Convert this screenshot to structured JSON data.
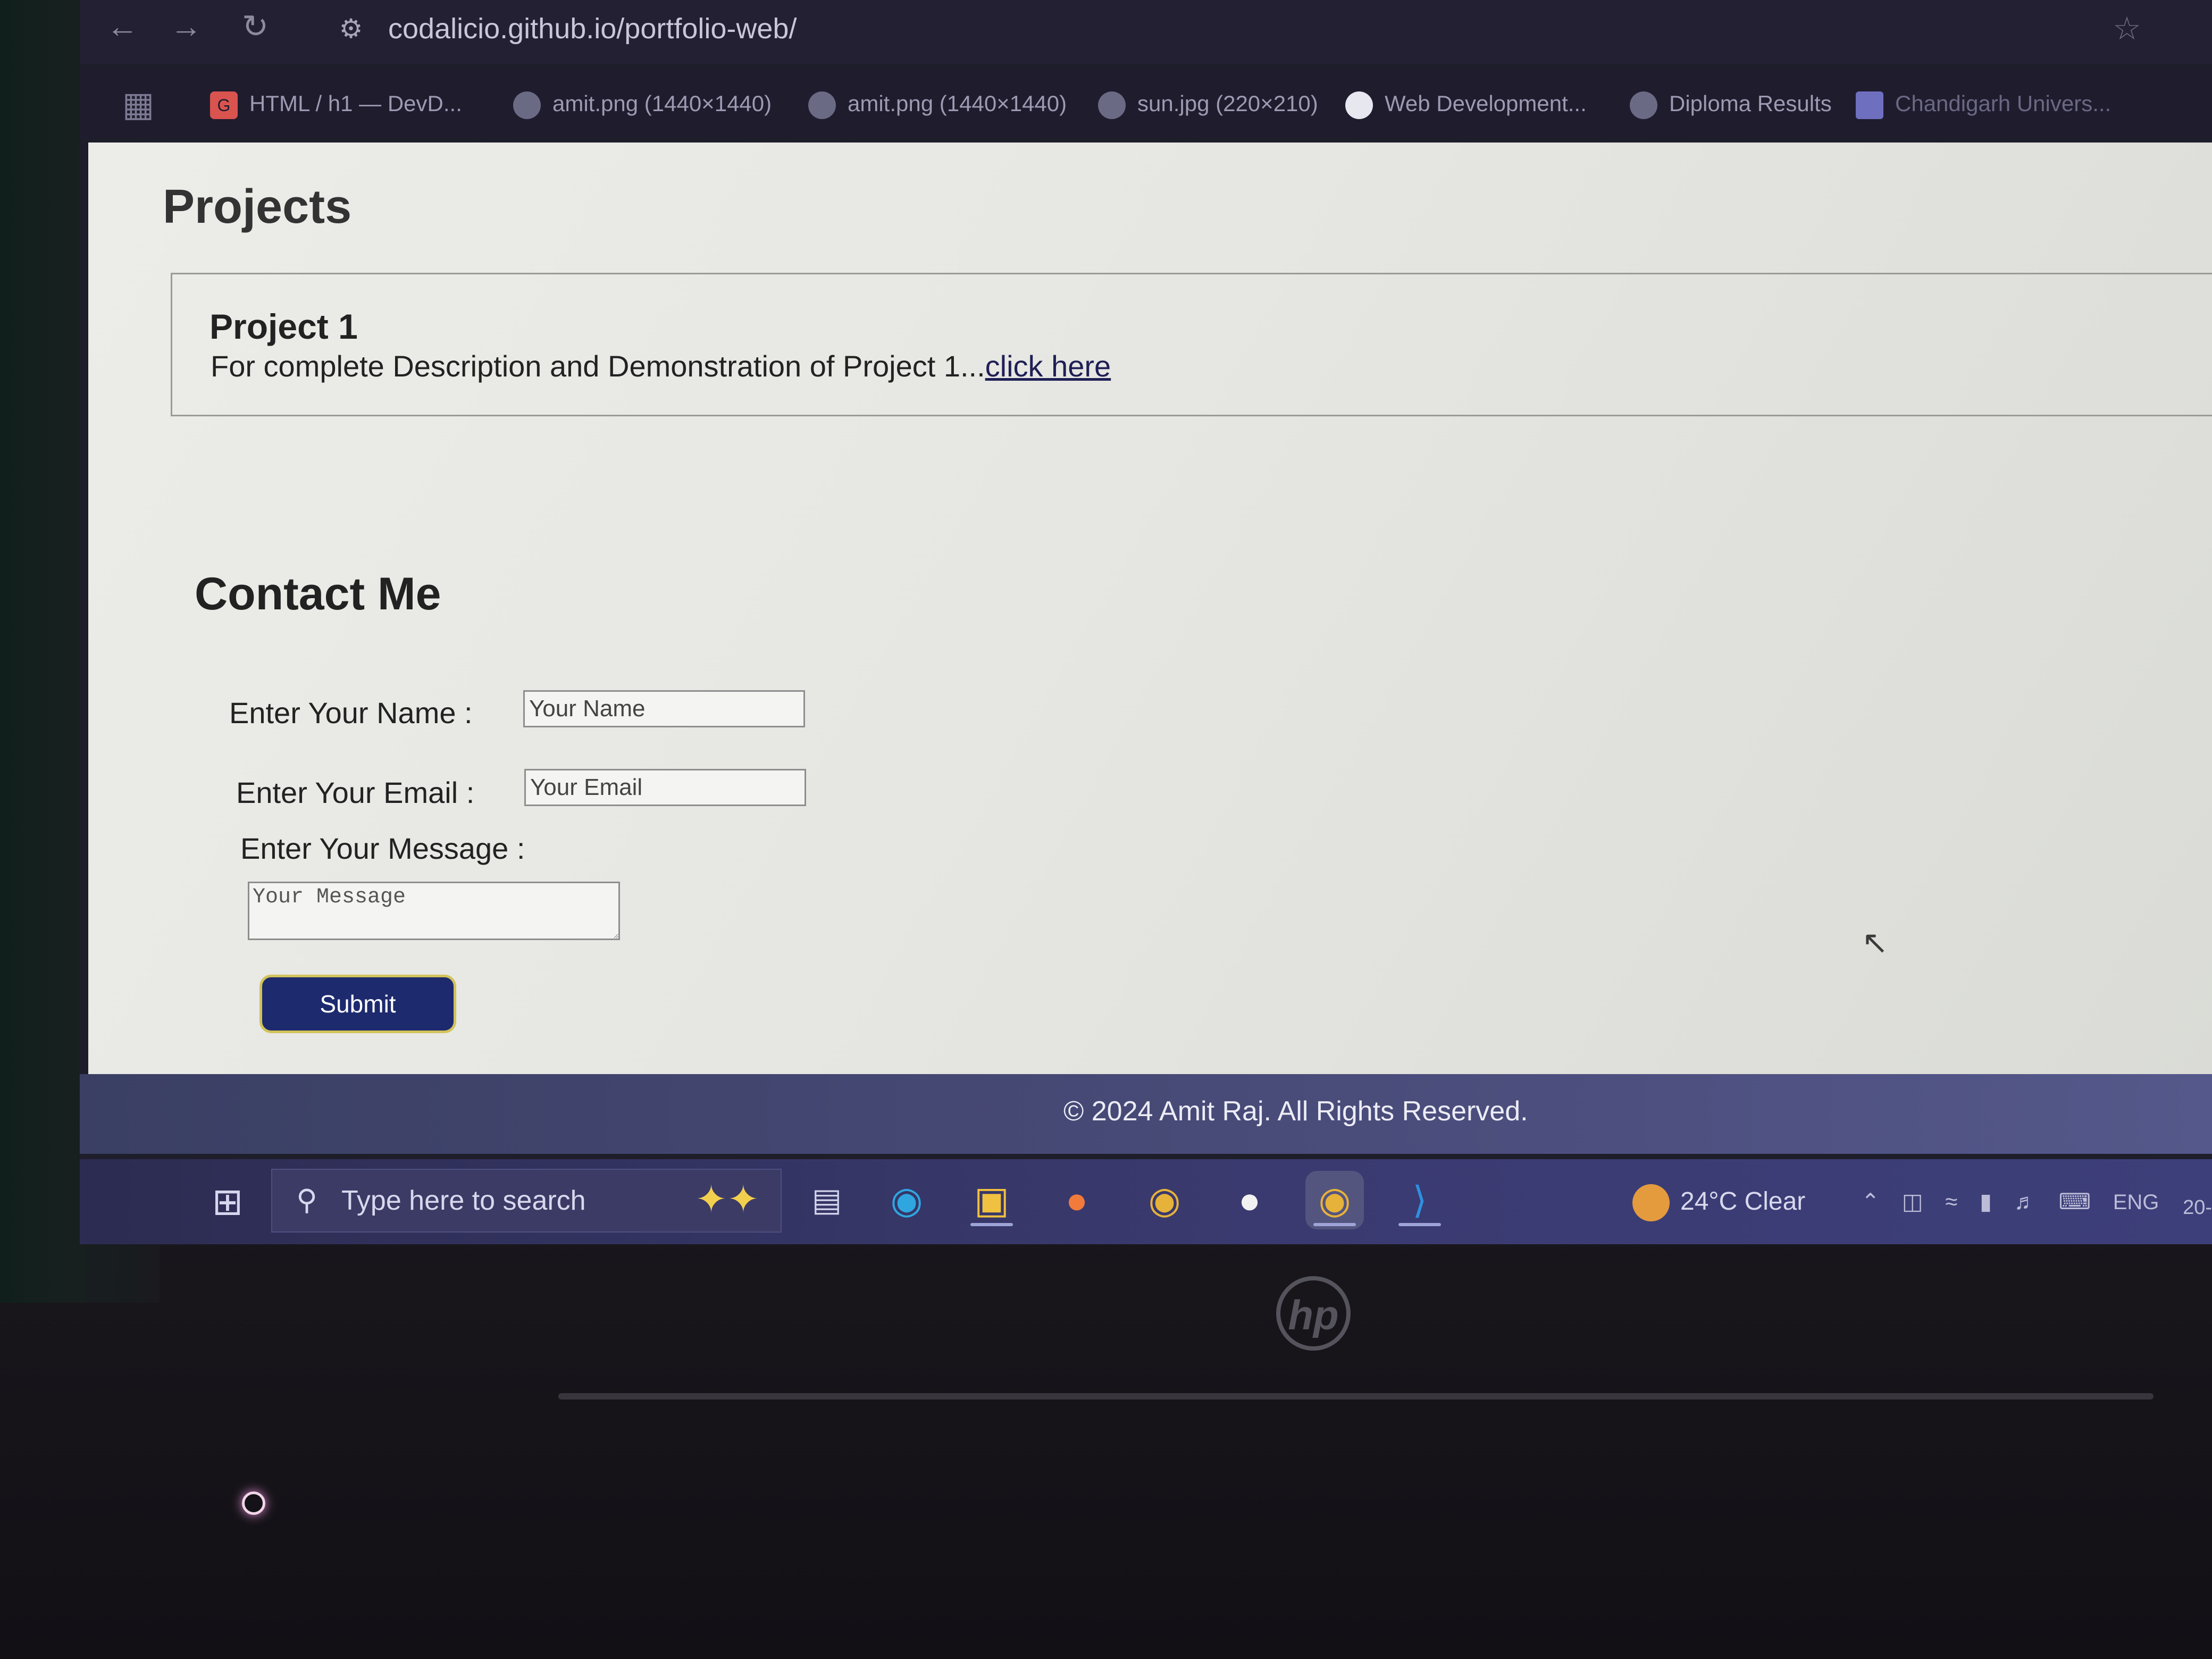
{
  "browser": {
    "url": "codalicio.github.io/portfolio-web/",
    "nav": {
      "back_icon": "arrow-left-icon",
      "forward_icon": "arrow-right-icon",
      "reload_icon": "reload-icon"
    },
    "bookmarks": [
      {
        "label": "HTML / h1 — DevD...",
        "icon": "devdocs-icon"
      },
      {
        "label": "amit.png (1440×1440)",
        "icon": "globe-icon"
      },
      {
        "label": "amit.png (1440×1440)",
        "icon": "globe-icon"
      },
      {
        "label": "sun.jpg (220×210)",
        "icon": "globe-icon"
      },
      {
        "label": "Web Development...",
        "icon": "site-icon"
      },
      {
        "label": "Diploma Results",
        "icon": "globe-icon"
      },
      {
        "label": "Chandigarh Univers...",
        "icon": "list-icon"
      }
    ]
  },
  "page": {
    "projects_title": "Projects",
    "project": {
      "name": "Project 1",
      "description": "For complete Description and Demonstration of Project 1...",
      "link_text": "click here"
    },
    "contact": {
      "title": "Contact Me",
      "name_label": "Enter Your Name :",
      "name_placeholder": "Your Name",
      "email_label": "Enter Your Email :",
      "email_placeholder": "Your Email",
      "message_label": "Enter Your Message :",
      "message_placeholder": "Your Message",
      "submit_label": "Submit"
    },
    "footer": "© 2024 Amit Raj. All Rights Reserved."
  },
  "taskbar": {
    "search_placeholder": "Type here to search",
    "apps": [
      "task-view-icon",
      "edge-icon",
      "file-explorer-icon",
      "firefox-icon",
      "chrome-icon",
      "app-icon",
      "chrome-icon",
      "vscode-icon"
    ],
    "weather": "24°C  Clear",
    "language": "ENG",
    "clock": "20-"
  },
  "colors": {
    "submit_bg": "#1d2a6e",
    "submit_border": "#d2c25a",
    "footer_bg": "#3a3f63",
    "taskbar_bg": "#2c2c52"
  }
}
